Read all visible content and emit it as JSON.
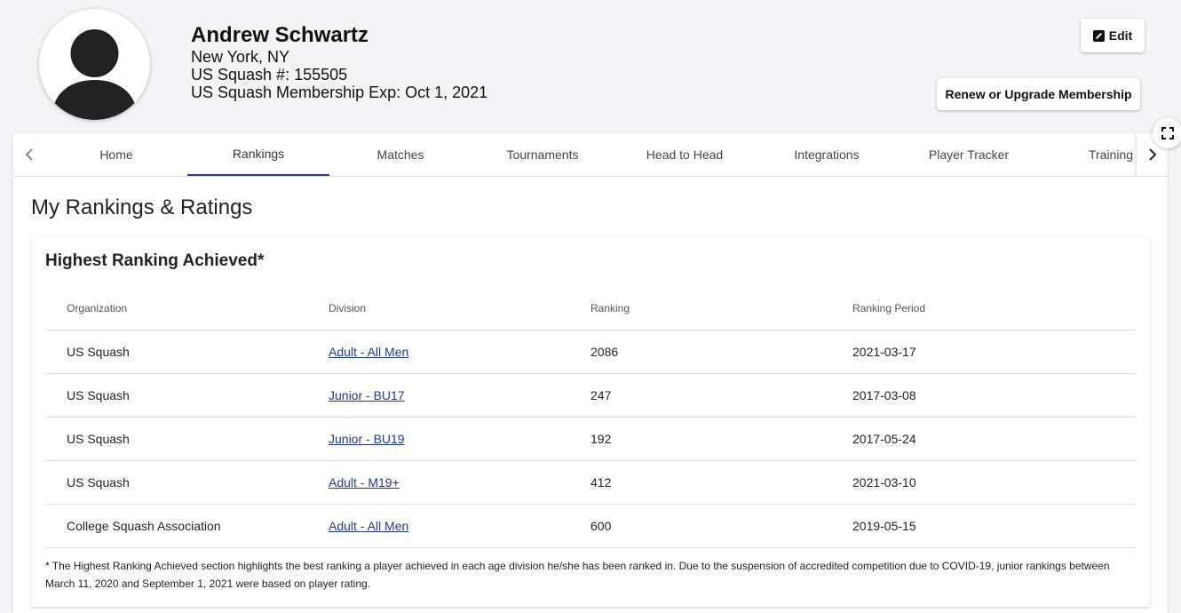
{
  "profile": {
    "name": "Andrew Schwartz",
    "location": "New York, NY",
    "member_number": "US Squash #: 155505",
    "membership_exp": "US Squash Membership Exp: Oct 1, 2021",
    "avatar_icon": "user-silhouette-icon"
  },
  "actions": {
    "edit_label": "Edit",
    "edit_icon": "pencil-square-icon",
    "renew_label": "Renew or Upgrade Membership",
    "expand_icon": "fullscreen-icon"
  },
  "tabs": [
    {
      "label": "Home"
    },
    {
      "label": "Rankings"
    },
    {
      "label": "Matches"
    },
    {
      "label": "Tournaments"
    },
    {
      "label": "Head to Head"
    },
    {
      "label": "Integrations"
    },
    {
      "label": "Player Tracker"
    },
    {
      "label": "Training"
    }
  ],
  "active_tab": "Rankings",
  "section_title": "My Rankings & Ratings",
  "highest_ranking": {
    "title": "Highest Ranking Achieved*",
    "columns": [
      "Organization",
      "Division",
      "Ranking",
      "Ranking Period"
    ],
    "rows": [
      {
        "organization": "US Squash",
        "division": "Adult - All Men",
        "ranking": "2086",
        "period": "2021-03-17"
      },
      {
        "organization": "US Squash",
        "division": "Junior - BU17",
        "ranking": "247",
        "period": "2017-03-08"
      },
      {
        "organization": "US Squash",
        "division": "Junior - BU19",
        "ranking": "192",
        "period": "2017-05-24"
      },
      {
        "organization": "US Squash",
        "division": "Adult - M19+",
        "ranking": "412",
        "period": "2021-03-10"
      },
      {
        "organization": "College Squash Association",
        "division": "Adult - All Men",
        "ranking": "600",
        "period": "2019-05-15"
      }
    ],
    "footnote": "* The Highest Ranking Achieved section highlights the best ranking a player achieved in each age division he/she has been ranked in. Due to the suspension of accredited competition due to COVID-19, junior rankings between March 11, 2020 and September 1, 2021 were based on player rating."
  },
  "colors": {
    "accent": "#2b3a78",
    "link": "#1f3a8a",
    "background": "#f4f4f7"
  }
}
